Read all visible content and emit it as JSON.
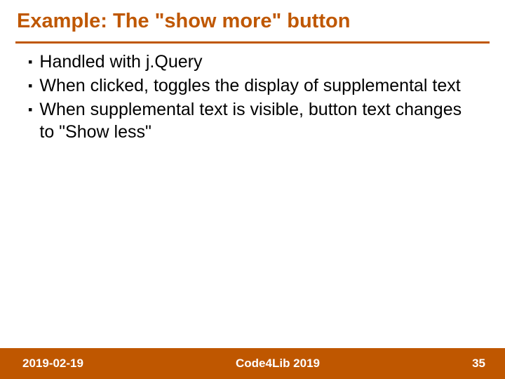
{
  "slide": {
    "title": "Example: The \"show more\" button",
    "bullets": [
      "Handled with j.Query",
      "When clicked, toggles the display of supplemental text",
      "When supplemental text is visible, button text changes to \"Show less\""
    ]
  },
  "footer": {
    "date": "2019-02-19",
    "event": "Code4Lib 2019",
    "page": "35"
  },
  "colors": {
    "accent": "#bf5700"
  }
}
